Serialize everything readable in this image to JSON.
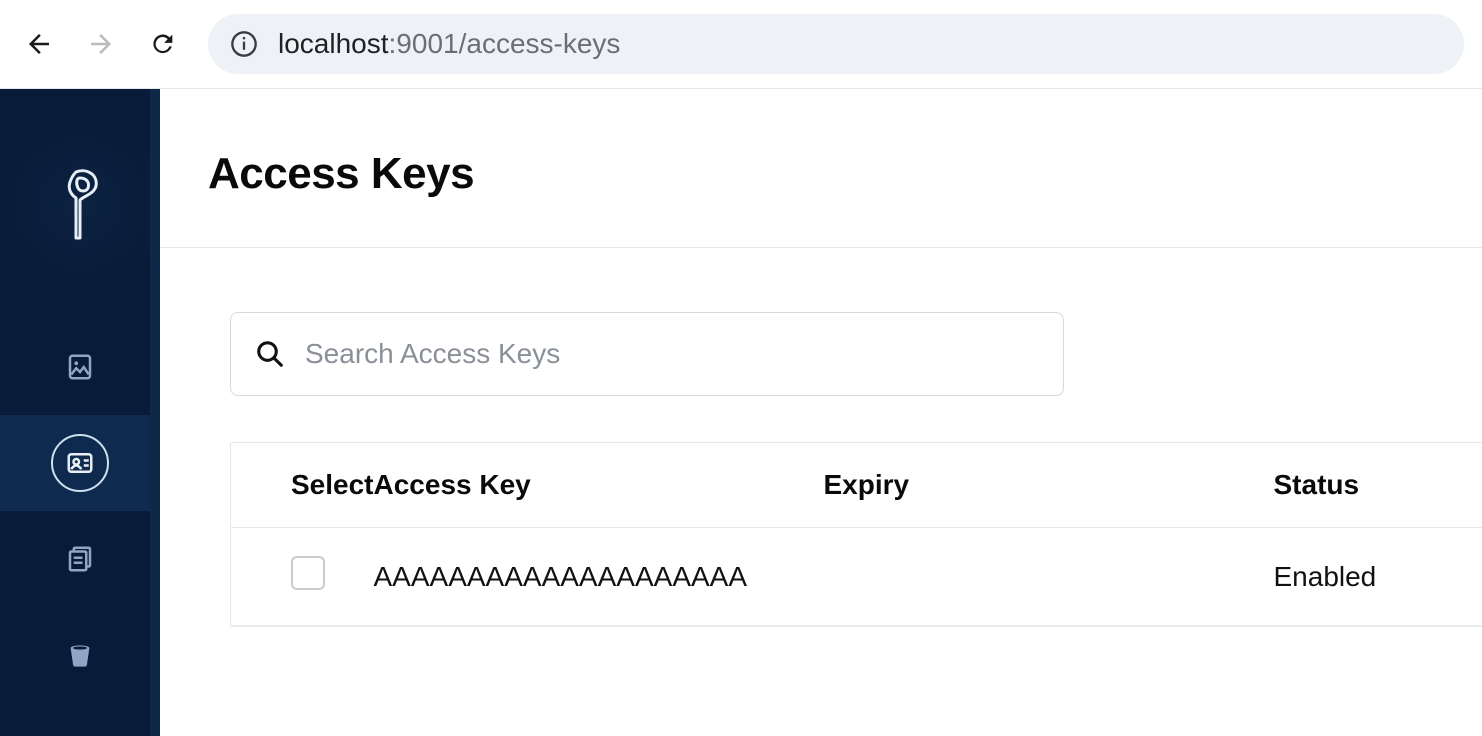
{
  "browser": {
    "url_host": "localhost",
    "url_port": ":9001",
    "url_path": "/access-keys"
  },
  "page": {
    "title": "Access Keys"
  },
  "search": {
    "placeholder": "Search Access Keys"
  },
  "table": {
    "columns": {
      "select": "Select",
      "access_key": "Access Key",
      "expiry": "Expiry",
      "status": "Status"
    },
    "rows": [
      {
        "access_key": "AAAAAAAAAAAAAAAAAAAA",
        "expiry": "",
        "status": "Enabled"
      }
    ]
  }
}
